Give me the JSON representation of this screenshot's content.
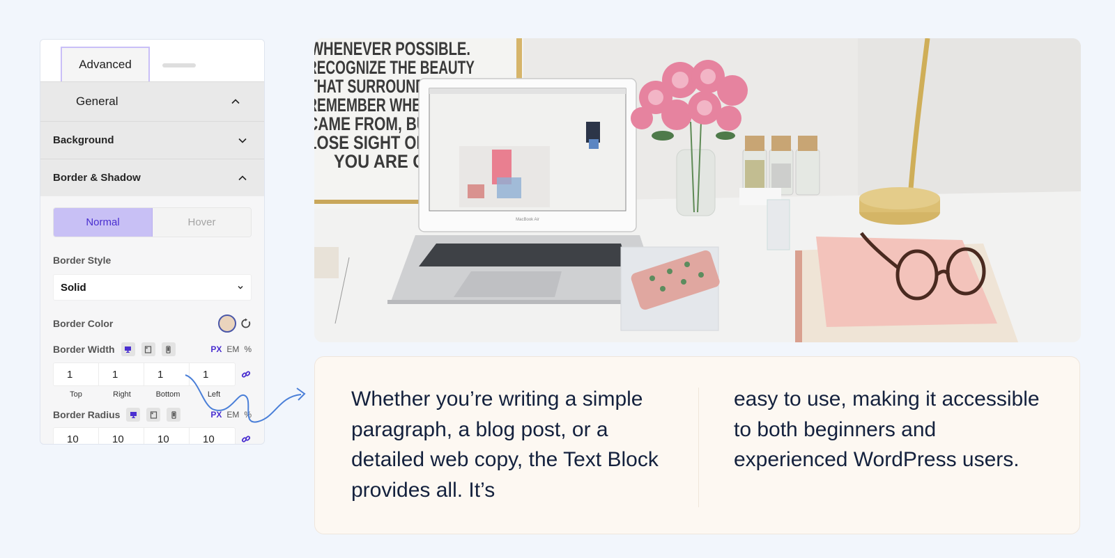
{
  "panel": {
    "tabs": [
      {
        "label": "Advanced",
        "active": true
      }
    ],
    "sections": {
      "general": {
        "label": "General",
        "expanded": true
      },
      "background": {
        "label": "Background",
        "expanded": false
      },
      "border_shadow": {
        "label": "Border & Shadow",
        "expanded": true
      }
    },
    "state_toggle": {
      "normal": "Normal",
      "hover": "Hover",
      "selected": "Normal"
    },
    "border_style": {
      "label": "Border Style",
      "value": "Solid"
    },
    "border_color": {
      "label": "Border Color",
      "swatch": "#ead4bd",
      "reset_icon": "reset-icon"
    },
    "border_width": {
      "label": "Border Width",
      "devices": [
        "desktop-icon",
        "tablet-icon",
        "mobile-icon"
      ],
      "units": [
        "PX",
        "EM",
        "%"
      ],
      "active_unit": "PX",
      "values": {
        "top": "1",
        "right": "1",
        "bottom": "1",
        "left": "1"
      },
      "captions": {
        "top": "Top",
        "right": "Right",
        "bottom": "Bottom",
        "left": "Left"
      },
      "linked_icon": "link-icon"
    },
    "border_radius": {
      "label": "Border Radius",
      "devices": [
        "desktop-icon",
        "tablet-icon",
        "mobile-icon"
      ],
      "units": [
        "PX",
        "EM",
        "%"
      ],
      "active_unit": "PX",
      "values": {
        "top": "10",
        "right": "10",
        "bottom": "10",
        "left": "10"
      }
    }
  },
  "photo": {
    "poster_lines": [
      "WHENEVER POSSIBLE.",
      "RECOGNIZE THE BEAUTY",
      "THAT SURROUNDS",
      "REMEMBER WHERE",
      "CAME FROM, BUT",
      "LOSE SIGHT OF",
      "YOU ARE GO"
    ],
    "laptop_label": "MacBook Air"
  },
  "text_block": {
    "column_1": "Whether you’re writing a simple paragraph, a blog post, or a detailed web copy, the Text Block provides all. It’s",
    "column_2": "easy to use, making it accessible to both beginners and experienced WordPress users."
  },
  "colors": {
    "accent": "#4a2fd0",
    "toggle_active_bg": "#c8c0f5",
    "arrow": "#4a7fd8",
    "card_bg": "#fdf8f2",
    "text": "#14213d"
  }
}
